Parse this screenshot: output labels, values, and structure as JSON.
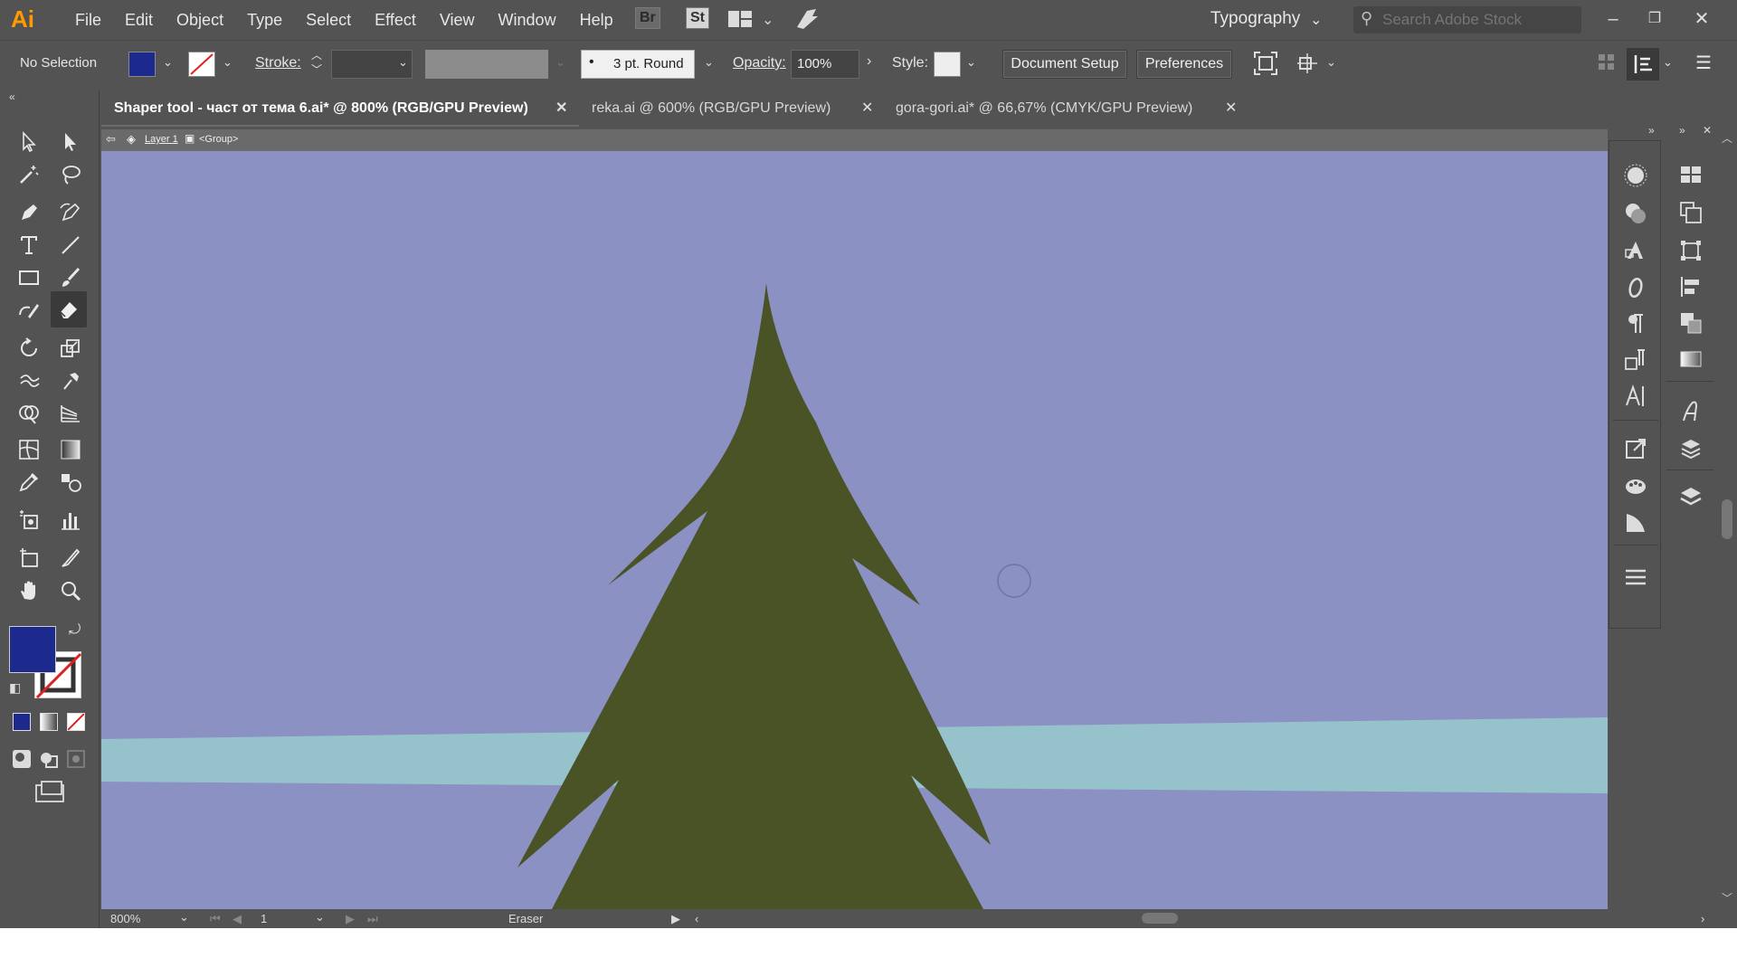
{
  "app": {
    "logo": "Ai"
  },
  "menu": [
    "File",
    "Edit",
    "Object",
    "Type",
    "Select",
    "Effect",
    "View",
    "Window",
    "Help"
  ],
  "menubar": {
    "bridge": "Br",
    "stock": "St",
    "workspace": "Typography",
    "search_placeholder": "Search Adobe Stock"
  },
  "control": {
    "selection": "No Selection",
    "stroke_label": "Stroke:",
    "brush": "3 pt. Round",
    "opacity_label": "Opacity:",
    "opacity_value": "100%",
    "style_label": "Style:",
    "document_setup": "Document Setup",
    "preferences": "Preferences",
    "fill_color": "#1b2a8c"
  },
  "tabs": [
    {
      "label": "Shaper tool - част от тема 6.ai* @ 800% (RGB/GPU Preview)",
      "active": true
    },
    {
      "label": "reka.ai @ 600% (RGB/GPU Preview)",
      "active": false
    },
    {
      "label": "gora-gori.ai* @ 66,67% (CMYK/GPU Preview)",
      "active": false
    }
  ],
  "breadcrumb": {
    "layer": "Layer 1",
    "group": "<Group>"
  },
  "canvas": {
    "sky_color": "#8b91c3",
    "river_color": "#96c2cc",
    "tree_color": "#495325"
  },
  "status": {
    "zoom": "800%",
    "artboard": "1",
    "tool": "Eraser"
  }
}
